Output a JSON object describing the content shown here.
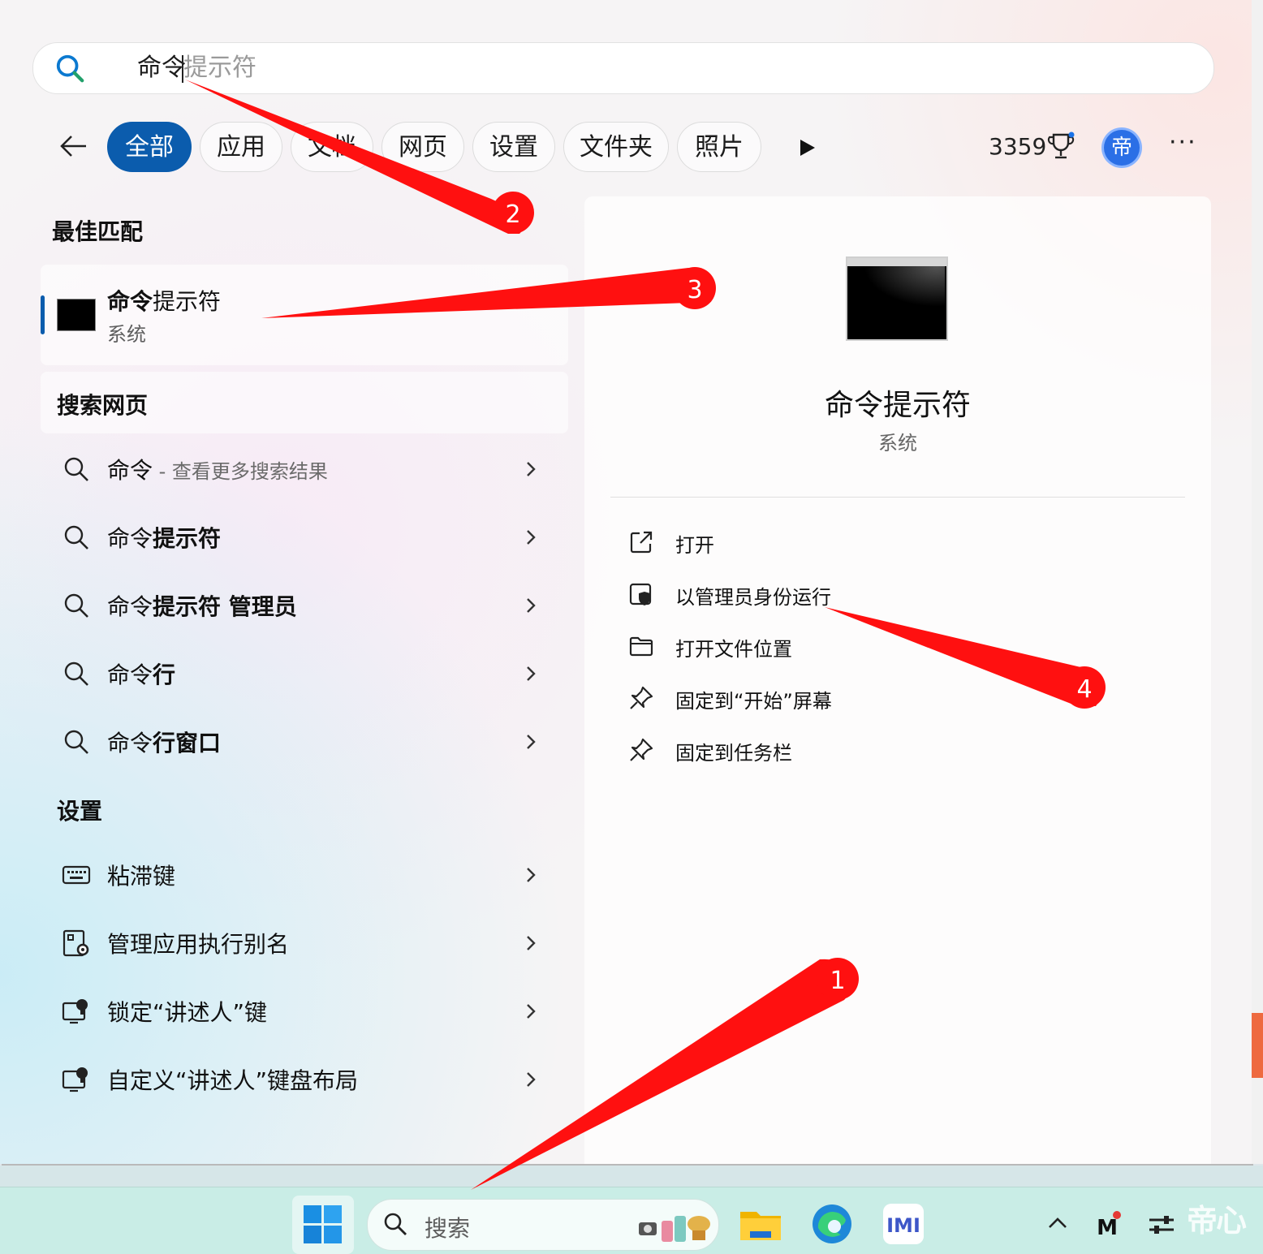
{
  "search": {
    "typed": "命令",
    "suggestion": "提示符"
  },
  "filters": [
    "全部",
    "应用",
    "文档",
    "网页",
    "设置",
    "文件夹",
    "照片"
  ],
  "header": {
    "points": "3359",
    "avatar_char": "帝"
  },
  "best_match": {
    "section_title": "最佳匹配",
    "name_bold": "命令",
    "name_rest": "提示符",
    "subtitle": "系统"
  },
  "web": {
    "section_title": "搜索网页",
    "items": [
      {
        "plain": "命令",
        "bold": "",
        "sub": " - 查看更多搜索结果"
      },
      {
        "plain": "命令",
        "bold": "提示符",
        "sub": ""
      },
      {
        "plain": "命令",
        "bold": "提示符 管理员",
        "sub": ""
      },
      {
        "plain": "命令",
        "bold": "行",
        "sub": ""
      },
      {
        "plain": "命令",
        "bold": "行窗口",
        "sub": ""
      }
    ]
  },
  "settings": {
    "section_title": "设置",
    "items": [
      {
        "label": "粘滞键",
        "icon": "keyboard-icon"
      },
      {
        "label": "管理应用执行别名",
        "icon": "app-settings-icon"
      },
      {
        "label": "锁定“讲述人”键",
        "icon": "narrator-icon"
      },
      {
        "label": "自定义“讲述人”键盘布局",
        "icon": "narrator-icon"
      }
    ]
  },
  "detail": {
    "title": "命令提示符",
    "subtitle": "系统",
    "actions": [
      {
        "label": "打开",
        "icon": "open-external-icon"
      },
      {
        "label": "以管理员身份运行",
        "icon": "shield-admin-icon"
      },
      {
        "label": "打开文件位置",
        "icon": "folder-icon"
      },
      {
        "label": "固定到“开始”屏幕",
        "icon": "pin-icon"
      },
      {
        "label": "固定到任务栏",
        "icon": "pin-icon"
      }
    ]
  },
  "taskbar": {
    "search_placeholder": "搜索",
    "watermark": "帝心"
  },
  "annotations": [
    "1",
    "2",
    "3",
    "4"
  ],
  "colors": {
    "accent": "#0b5cad",
    "annotation": "#ff1010",
    "taskbar": "#c9ede6"
  }
}
